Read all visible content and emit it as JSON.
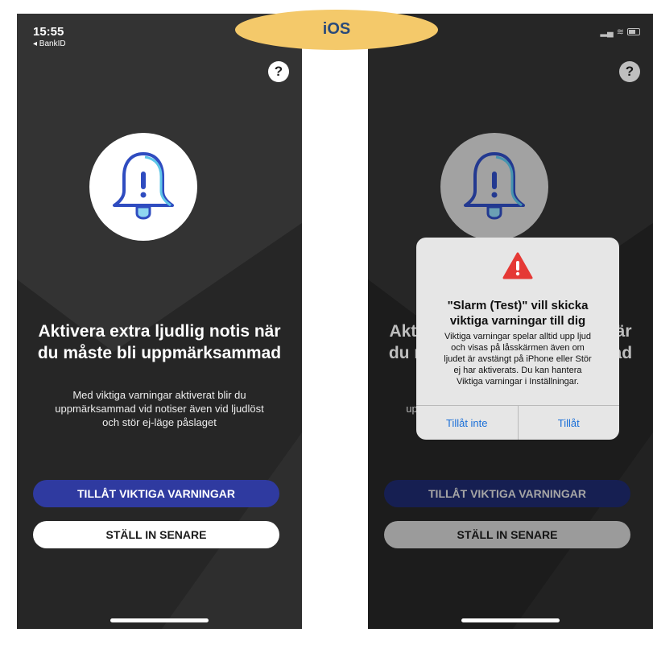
{
  "badge": {
    "label": "iOS"
  },
  "status_bar": {
    "time": "15:55",
    "back_app": "◂ BankID"
  },
  "help": {
    "label": "?"
  },
  "screen": {
    "headline": [
      "Aktivera extra ljudlig notis när",
      "du måste bli uppmärksammad"
    ],
    "description": [
      "Med viktiga varningar aktiverat blir du",
      "uppmärksammad vid notiser även vid ljudlöst",
      "och stör ej-läge påslaget"
    ],
    "allow_button": "TILLÅT VIKTIGA VARNINGAR",
    "later_button": "STÄLL IN SENARE"
  },
  "alert": {
    "title": [
      "\"Slarm (Test)\" vill skicka",
      "viktiga varningar till dig"
    ],
    "message": [
      "Viktiga varningar spelar alltid upp ljud",
      "och visas på låsskärmen även om",
      "ljudet är avstängt på iPhone eller Stör",
      "ej har aktiverats. Du kan hantera",
      "Viktiga varningar i Inställningar."
    ],
    "deny_button": "Tillåt inte",
    "allow_button": "Tillåt"
  },
  "colors": {
    "primary_button": "#2f3aa0",
    "alert_link": "#1a6fd8",
    "badge": "#f4c96a",
    "warning": "#e53935"
  }
}
